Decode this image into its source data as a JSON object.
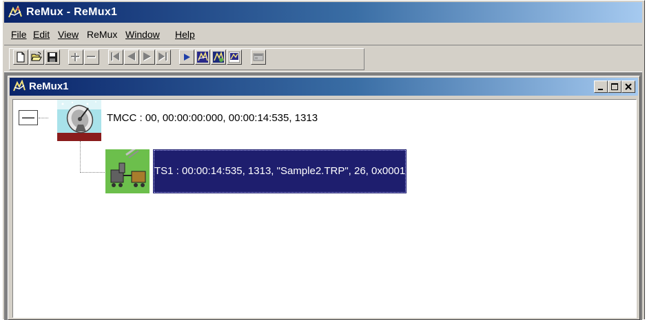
{
  "app": {
    "title": "ReMux - ReMux1",
    "icon": "remux-app-icon"
  },
  "menubar": {
    "items": [
      {
        "label": "File",
        "accel": "F"
      },
      {
        "label": "Edit",
        "accel": "E"
      },
      {
        "label": "View",
        "accel": "V"
      },
      {
        "label": "ReMux",
        "accel": ""
      },
      {
        "label": "Window",
        "accel": "W"
      },
      {
        "label": "Help",
        "accel": "H"
      }
    ]
  },
  "toolbar": {
    "buttons": [
      {
        "name": "new-document-icon",
        "enabled": true
      },
      {
        "name": "open-folder-icon",
        "enabled": true
      },
      {
        "name": "save-icon",
        "enabled": true
      },
      {
        "name": "add-icon",
        "enabled": false
      },
      {
        "name": "remove-icon",
        "enabled": false
      },
      {
        "name": "skip-to-start-icon",
        "enabled": false
      },
      {
        "name": "step-back-icon",
        "enabled": false
      },
      {
        "name": "step-forward-icon",
        "enabled": false
      },
      {
        "name": "skip-to-end-icon",
        "enabled": false
      },
      {
        "name": "play-icon",
        "enabled": true
      },
      {
        "name": "remux-run-icon",
        "enabled": true
      },
      {
        "name": "remux-settings-icon",
        "enabled": true
      },
      {
        "name": "remux-view-icon",
        "enabled": true
      },
      {
        "name": "window-panel-icon",
        "enabled": false
      }
    ]
  },
  "child_window": {
    "title": "ReMux1",
    "icon": "remux-doc-icon",
    "buttons": {
      "minimize": "minimize-icon",
      "restore": "restore-icon",
      "close": "close-icon"
    }
  },
  "tree": {
    "root": {
      "expander": "—",
      "icon": "satellite-dish-icon",
      "label": "TMCC : 00, 00:00:00:000, 00:00:14:535, 1313"
    },
    "child": {
      "icon": "transport-stream-icon",
      "label": "TS1 : 00:00:14:535, 1313, \"Sample2.TRP\", 26, 0x0001",
      "selected": true
    }
  },
  "colors": {
    "titlebar_start": "#0a246a",
    "titlebar_end": "#a6caf0",
    "face": "#d4d0c8",
    "selection": "#1e1e6e"
  }
}
